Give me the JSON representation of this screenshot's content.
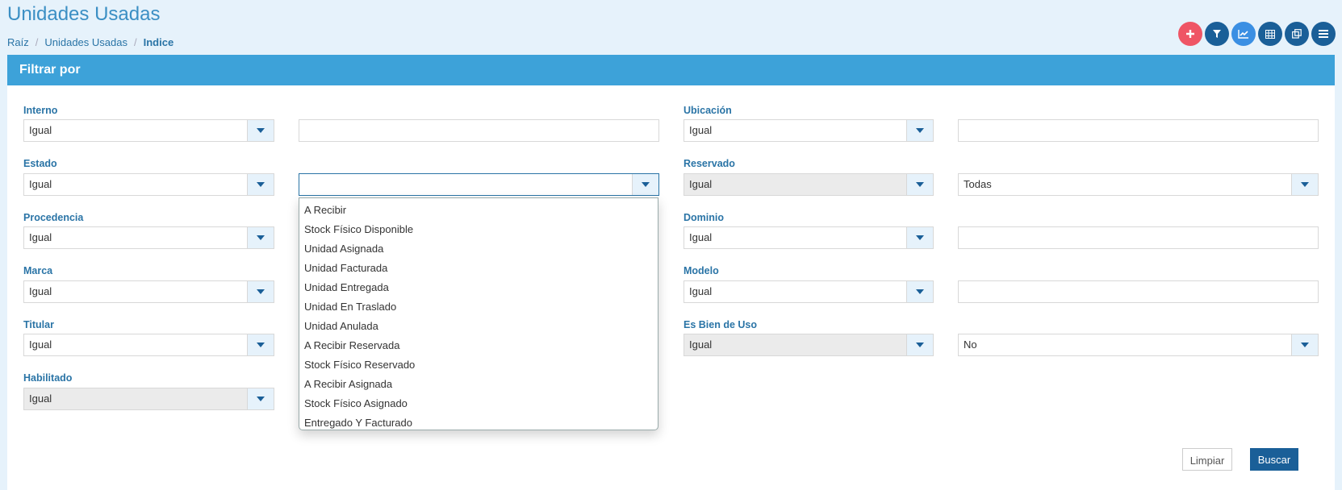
{
  "header": {
    "title": "Unidades Usadas",
    "breadcrumb": [
      "Raíz",
      "Unidades Usadas",
      "Indice"
    ]
  },
  "toolbar": {
    "buttons": [
      {
        "icon": "plus-icon",
        "color": "#ef5565"
      },
      {
        "icon": "filter-icon",
        "color": "#1a5f98"
      },
      {
        "icon": "chart-icon",
        "color": "#3a8fe3"
      },
      {
        "icon": "grid-icon",
        "color": "#1a5f98"
      },
      {
        "icon": "copy-icon",
        "color": "#1a5f98"
      },
      {
        "icon": "menu-icon",
        "color": "#1a5f98"
      }
    ]
  },
  "panel": {
    "title": "Filtrar por"
  },
  "filters": {
    "interno": {
      "label": "Interno",
      "operator": "Igual",
      "value": ""
    },
    "estado": {
      "label": "Estado",
      "operator": "Igual",
      "value": ""
    },
    "procedencia": {
      "label": "Procedencia",
      "operator": "Igual"
    },
    "marca": {
      "label": "Marca",
      "operator": "Igual"
    },
    "titular": {
      "label": "Titular",
      "operator": "Igual"
    },
    "habilitado": {
      "label": "Habilitado",
      "operator": "Igual"
    },
    "ubicacion": {
      "label": "Ubicación",
      "operator": "Igual",
      "value": ""
    },
    "reservado": {
      "label": "Reservado",
      "operator": "Igual",
      "value": "Todas"
    },
    "dominio": {
      "label": "Dominio",
      "operator": "Igual",
      "value": ""
    },
    "modelo": {
      "label": "Modelo",
      "operator": "Igual",
      "value": ""
    },
    "bien_de_uso": {
      "label": "Es Bien de Uso",
      "operator": "Igual",
      "value": "No"
    }
  },
  "estado_dropdown": {
    "options": [
      "A Recibir",
      "Stock Físico Disponible",
      "Unidad Asignada",
      "Unidad Facturada",
      "Unidad Entregada",
      "Unidad En Traslado",
      "Unidad Anulada",
      "A Recibir Reservada",
      "Stock Físico Reservado",
      "A Recibir Asignada",
      "Stock Físico Asignado",
      "Entregado Y Facturado"
    ]
  },
  "actions": {
    "clear_label": "Limpiar",
    "search_label": "Buscar"
  }
}
